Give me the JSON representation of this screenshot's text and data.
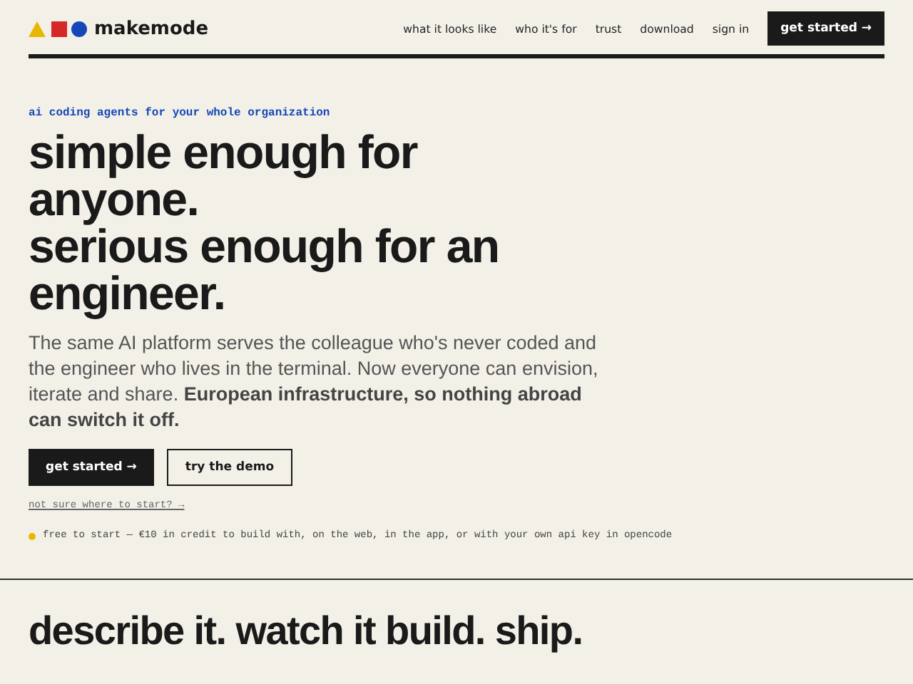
{
  "header": {
    "logo_text": "makemode",
    "nav": [
      {
        "label": "what it looks like"
      },
      {
        "label": "who it's for"
      },
      {
        "label": "trust"
      },
      {
        "label": "download"
      },
      {
        "label": "sign in"
      }
    ],
    "cta": "get started →"
  },
  "hero": {
    "eyebrow": "ai coding agents for your whole organization",
    "headline": [
      "simple enough for anyone.",
      "serious enough for an engineer."
    ],
    "body": "The same AI platform serves the colleague who's never coded and the engineer who lives in the terminal. Now everyone can envision, iterate and share. **European infrastructure, so nothing abroad can switch it off.**",
    "buttons": [
      {
        "label": "get started →",
        "kind": "primary"
      },
      {
        "label": "try the demo",
        "kind": "secondary"
      }
    ],
    "help_link": "not sure where to start? →",
    "note": {
      "color": "#e6b800",
      "text": "free to start — €10 in credit to build with, on the web, in the app, or with your own api key in opencode"
    }
  },
  "section": {
    "heading": "describe it. watch it build. ship."
  }
}
